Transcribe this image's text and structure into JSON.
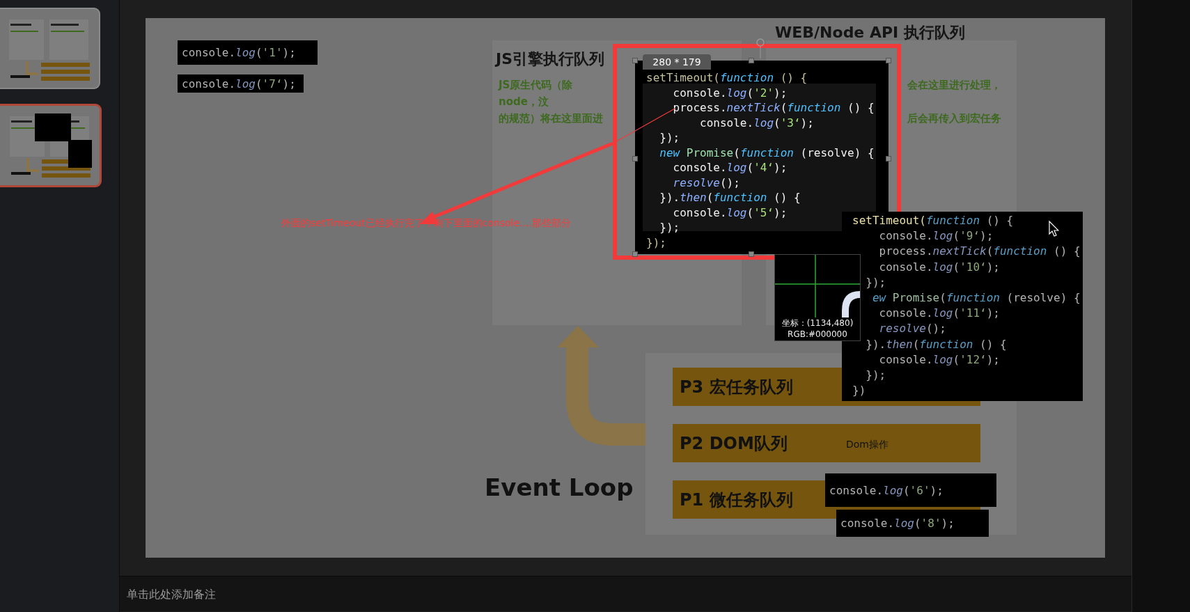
{
  "thumbnails": [
    {
      "selected": false
    },
    {
      "selected": true
    }
  ],
  "slide": {
    "code_snippets": [
      {
        "kind": "top",
        "line": [
          {
            "kind": "plain",
            "text": "console."
          },
          {
            "kind": "method",
            "text": "log"
          },
          {
            "kind": "plain",
            "text": "("
          },
          {
            "kind": "string",
            "text": "'1'"
          },
          {
            "kind": "plain",
            "text": ");"
          }
        ]
      },
      {
        "kind": "top2",
        "line": [
          {
            "kind": "plain",
            "text": "console."
          },
          {
            "kind": "method",
            "text": "log"
          },
          {
            "kind": "plain",
            "text": "("
          },
          {
            "kind": "string",
            "text": "'7‘"
          },
          {
            "kind": "plain",
            "text": ");"
          }
        ]
      },
      {
        "kind": "p1a",
        "line": [
          {
            "kind": "plain",
            "text": "console."
          },
          {
            "kind": "method",
            "text": "log"
          },
          {
            "kind": "plain",
            "text": "("
          },
          {
            "kind": "string",
            "text": "'6'"
          },
          {
            "kind": "plain",
            "text": ");"
          }
        ]
      },
      {
        "kind": "p1b",
        "line": [
          {
            "kind": "plain",
            "text": "console."
          },
          {
            "kind": "method",
            "text": "log"
          },
          {
            "kind": "plain",
            "text": "("
          },
          {
            "kind": "string",
            "text": "'8'"
          },
          {
            "kind": "plain",
            "text": ");"
          }
        ]
      }
    ],
    "left_panel": {
      "title": "JS引擎执行队列",
      "lines": [
        "JS原生代码（除node，汶",
        "的规范）将在这里面进"
      ]
    },
    "right_panel": {
      "title": "WEB/Node API 执行队列",
      "lines": [
        "会在这里进行处理，",
        "后会再传入到宏任务"
      ]
    },
    "queues": [
      {
        "label": "P3 宏任务队列"
      },
      {
        "label": "P2 DOM队列",
        "note": "Dom操作"
      },
      {
        "label": "P1 微任务队列"
      }
    ],
    "loop_title": "Event Loop",
    "annotation": "外面的setTimeout已经执行完了，剩下里面的console....那些部分"
  },
  "selection": {
    "size_label": "280 * 179",
    "code": [
      [
        {
          "kind": "dim",
          "text": "setTimeout("
        },
        {
          "kind": "keyword",
          "text": "function"
        },
        {
          "kind": "dim",
          "text": " () {"
        }
      ],
      [
        {
          "kind": "plain",
          "text": "    console."
        },
        {
          "kind": "method",
          "text": "log"
        },
        {
          "kind": "plain",
          "text": "("
        },
        {
          "kind": "string",
          "text": "'2'"
        },
        {
          "kind": "plain",
          "text": ");"
        }
      ],
      [
        {
          "kind": "plain",
          "text": "    process."
        },
        {
          "kind": "method",
          "text": "nextTick"
        },
        {
          "kind": "plain",
          "text": "("
        },
        {
          "kind": "keyword",
          "text": "function"
        },
        {
          "kind": "plain",
          "text": " () {"
        }
      ],
      [
        {
          "kind": "plain",
          "text": "        console."
        },
        {
          "kind": "method",
          "text": "log"
        },
        {
          "kind": "plain",
          "text": "("
        },
        {
          "kind": "string",
          "text": "'3‘"
        },
        {
          "kind": "plain",
          "text": ");"
        }
      ],
      [
        {
          "kind": "plain",
          "text": "  });"
        }
      ],
      [
        {
          "kind": "keyword",
          "text": "  new "
        },
        {
          "kind": "class",
          "text": "Promise"
        },
        {
          "kind": "plain",
          "text": "("
        },
        {
          "kind": "keyword",
          "text": "function"
        },
        {
          "kind": "plain",
          "text": " (resolve) {"
        }
      ],
      [
        {
          "kind": "plain",
          "text": "    console."
        },
        {
          "kind": "method",
          "text": "log"
        },
        {
          "kind": "plain",
          "text": "("
        },
        {
          "kind": "string",
          "text": "'4‘"
        },
        {
          "kind": "plain",
          "text": ");"
        }
      ],
      [
        {
          "kind": "method",
          "text": "    resolve"
        },
        {
          "kind": "plain",
          "text": "();"
        }
      ],
      [
        {
          "kind": "plain",
          "text": "  })."
        },
        {
          "kind": "method",
          "text": "then"
        },
        {
          "kind": "plain",
          "text": "("
        },
        {
          "kind": "keyword",
          "text": "function"
        },
        {
          "kind": "plain",
          "text": " () {"
        }
      ],
      [
        {
          "kind": "plain",
          "text": "    console."
        },
        {
          "kind": "method",
          "text": "log"
        },
        {
          "kind": "plain",
          "text": "("
        },
        {
          "kind": "string",
          "text": "'5‘"
        },
        {
          "kind": "plain",
          "text": ");"
        }
      ],
      [
        {
          "kind": "plain",
          "text": "  });"
        }
      ],
      [
        {
          "kind": "dim",
          "text": "});"
        }
      ]
    ]
  },
  "magnifier": {
    "coords": "坐标：(1134,480)",
    "rgb": "RGB:#000000"
  },
  "second_code": [
    [
      {
        "kind": "yellow",
        "text": "setTimeout("
      },
      {
        "kind": "keyword",
        "text": "function"
      },
      {
        "kind": "plain",
        "text": " () {"
      }
    ],
    [
      {
        "kind": "plain",
        "text": "    console."
      },
      {
        "kind": "method",
        "text": "log"
      },
      {
        "kind": "plain",
        "text": "("
      },
      {
        "kind": "string",
        "text": "'9‘"
      },
      {
        "kind": "plain",
        "text": ");"
      }
    ],
    [
      {
        "kind": "plain",
        "text": "    process."
      },
      {
        "kind": "method",
        "text": "nextTick"
      },
      {
        "kind": "plain",
        "text": "("
      },
      {
        "kind": "keyword",
        "text": "function"
      },
      {
        "kind": "plain",
        "text": " () {"
      }
    ],
    [
      {
        "kind": "plain",
        "text": "    console."
      },
      {
        "kind": "method",
        "text": "log"
      },
      {
        "kind": "plain",
        "text": "("
      },
      {
        "kind": "string",
        "text": "'10‘"
      },
      {
        "kind": "plain",
        "text": ");"
      }
    ],
    [
      {
        "kind": "plain",
        "text": "  });"
      }
    ],
    [
      {
        "kind": "keyword",
        "text": "   ew "
      },
      {
        "kind": "class",
        "text": "Promise"
      },
      {
        "kind": "plain",
        "text": "("
      },
      {
        "kind": "keyword",
        "text": "function"
      },
      {
        "kind": "plain",
        "text": " (resolve) {"
      }
    ],
    [
      {
        "kind": "plain",
        "text": "    console."
      },
      {
        "kind": "method",
        "text": "log"
      },
      {
        "kind": "plain",
        "text": "("
      },
      {
        "kind": "string",
        "text": "'11‘"
      },
      {
        "kind": "plain",
        "text": ");"
      }
    ],
    [
      {
        "kind": "method",
        "text": "    resolve"
      },
      {
        "kind": "plain",
        "text": "();"
      }
    ],
    [
      {
        "kind": "plain",
        "text": "  })."
      },
      {
        "kind": "method",
        "text": "then"
      },
      {
        "kind": "plain",
        "text": "("
      },
      {
        "kind": "keyword",
        "text": "function"
      },
      {
        "kind": "plain",
        "text": " () {"
      }
    ],
    [
      {
        "kind": "plain",
        "text": "    console."
      },
      {
        "kind": "method",
        "text": "log"
      },
      {
        "kind": "plain",
        "text": "("
      },
      {
        "kind": "string",
        "text": "'12‘"
      },
      {
        "kind": "plain",
        "text": ");"
      }
    ],
    [
      {
        "kind": "plain",
        "text": "  });"
      }
    ],
    [
      {
        "kind": "plain",
        "text": "})"
      }
    ]
  ],
  "notes": {
    "placeholder": "单击此处添加备注"
  }
}
